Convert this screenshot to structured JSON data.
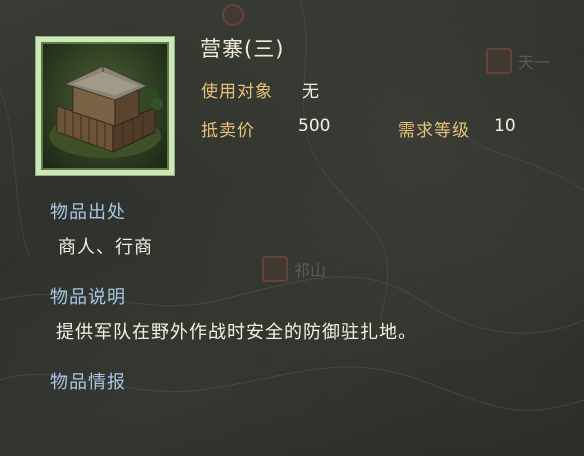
{
  "item": {
    "name": "营寨(三)",
    "usage_label": "使用对象",
    "usage_value": "无",
    "price_label": "抵卖价",
    "price_value": "500",
    "level_label": "需求等级",
    "level_value": "10"
  },
  "sections": {
    "source_heading": "物品出处",
    "source_text": "商人、行商",
    "description_heading": "物品说明",
    "description_text": "提供军队在野外作战时安全的防御驻扎地。",
    "intel_heading": "物品情报"
  },
  "map": {
    "marker_top_right_label": "天一",
    "marker_mid_label": "祁山"
  },
  "colors": {
    "label": "#e6c27a",
    "heading": "#a9c6e6",
    "value": "#f4f0e4",
    "frame": "#cfe6b8"
  }
}
